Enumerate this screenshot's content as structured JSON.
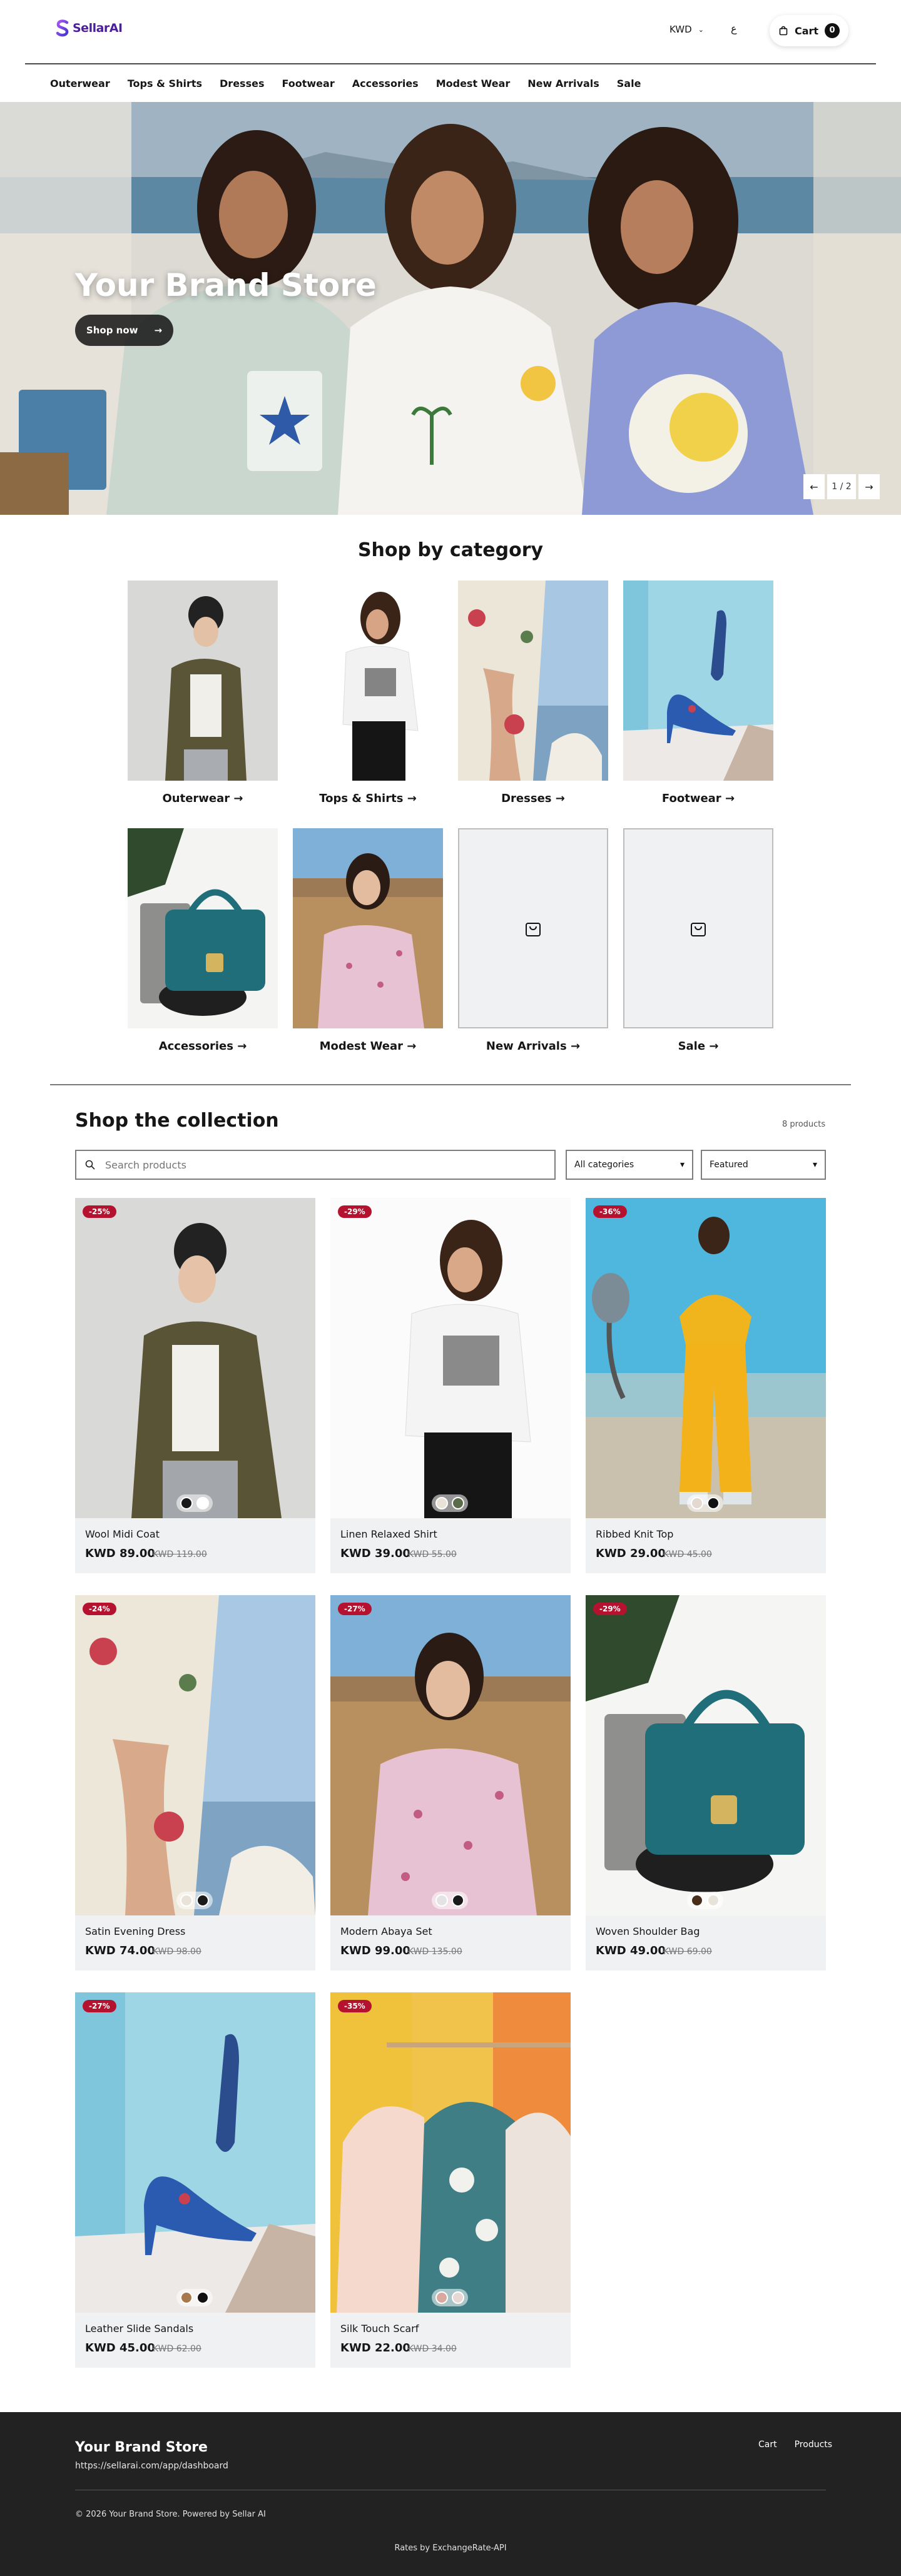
{
  "header": {
    "logo_text": "SellarAI",
    "currency": "KWD",
    "language": "ع",
    "cart_label": "Cart",
    "cart_count": "0"
  },
  "nav": [
    "Outerwear",
    "Tops & Shirts",
    "Dresses",
    "Footwear",
    "Accessories",
    "Modest Wear",
    "New Arrivals",
    "Sale"
  ],
  "hero": {
    "title": "Your Brand Store",
    "button": "Shop now",
    "pager": "1 / 2"
  },
  "categories": {
    "title": "Shop by category",
    "items": [
      {
        "label": "Outerwear",
        "image": "jacket-beanie-woman"
      },
      {
        "label": "Tops & Shirts",
        "image": "graphic-tee-woman"
      },
      {
        "label": "Dresses",
        "image": "floral-dress"
      },
      {
        "label": "Footwear",
        "image": "floral-heels"
      },
      {
        "label": "Accessories",
        "image": "teal-handbag"
      },
      {
        "label": "Modest Wear",
        "image": "pink-ruffle-top-woman"
      },
      {
        "label": "New Arrivals",
        "image": "bag-icon-placeholder"
      },
      {
        "label": "Sale",
        "image": "bag-icon-placeholder"
      }
    ]
  },
  "collection": {
    "title": "Shop the collection",
    "count": "8 products",
    "search_placeholder": "Search products",
    "category_select": "All categories",
    "sort_select": "Featured",
    "products": [
      {
        "name": "Wool Midi Coat",
        "price": "KWD 89.00",
        "old_price": "KWD 119.00",
        "discount": "-25%",
        "swatches": [
          "#1a1a1a",
          "#ffffff"
        ]
      },
      {
        "name": "Linen Relaxed Shirt",
        "price": "KWD 39.00",
        "old_price": "KWD 55.00",
        "discount": "-29%",
        "swatches": [
          "#e8e3d6",
          "#5c6b4a"
        ]
      },
      {
        "name": "Ribbed Knit Top",
        "price": "KWD 29.00",
        "old_price": "KWD 45.00",
        "discount": "-36%",
        "swatches": [
          "#e3d9d0",
          "#111111"
        ]
      },
      {
        "name": "Satin Evening Dress",
        "price": "KWD 74.00",
        "old_price": "KWD 98.00",
        "discount": "-24%",
        "swatches": [
          "#e9e2d8",
          "#1a1a1a"
        ]
      },
      {
        "name": "Modern Abaya Set",
        "price": "KWD 99.00",
        "old_price": "KWD 135.00",
        "discount": "-27%",
        "swatches": [
          "#e3e3e3",
          "#1a1a1a"
        ]
      },
      {
        "name": "Woven Shoulder Bag",
        "price": "KWD 49.00",
        "old_price": "KWD 69.00",
        "discount": "-29%",
        "swatches": [
          "#4a2e1c",
          "#e8e3da"
        ]
      },
      {
        "name": "Leather Slide Sandals",
        "price": "KWD 45.00",
        "old_price": "KWD 62.00",
        "discount": "-27%",
        "swatches": [
          "#a8794a",
          "#111111"
        ]
      },
      {
        "name": "Silk Touch Scarf",
        "price": "KWD 22.00",
        "old_price": "KWD 34.00",
        "discount": "-35%",
        "swatches": [
          "#d9a9a0",
          "#e6d8d4"
        ]
      }
    ]
  },
  "footer": {
    "brand": "Your Brand Store",
    "url": "https://sellarai.com/app/dashboard",
    "links": [
      "Cart",
      "Products"
    ],
    "copyright": "© 2026 Your Brand Store. Powered by Sellar AI",
    "rates": "Rates by ExchangeRate-API"
  }
}
